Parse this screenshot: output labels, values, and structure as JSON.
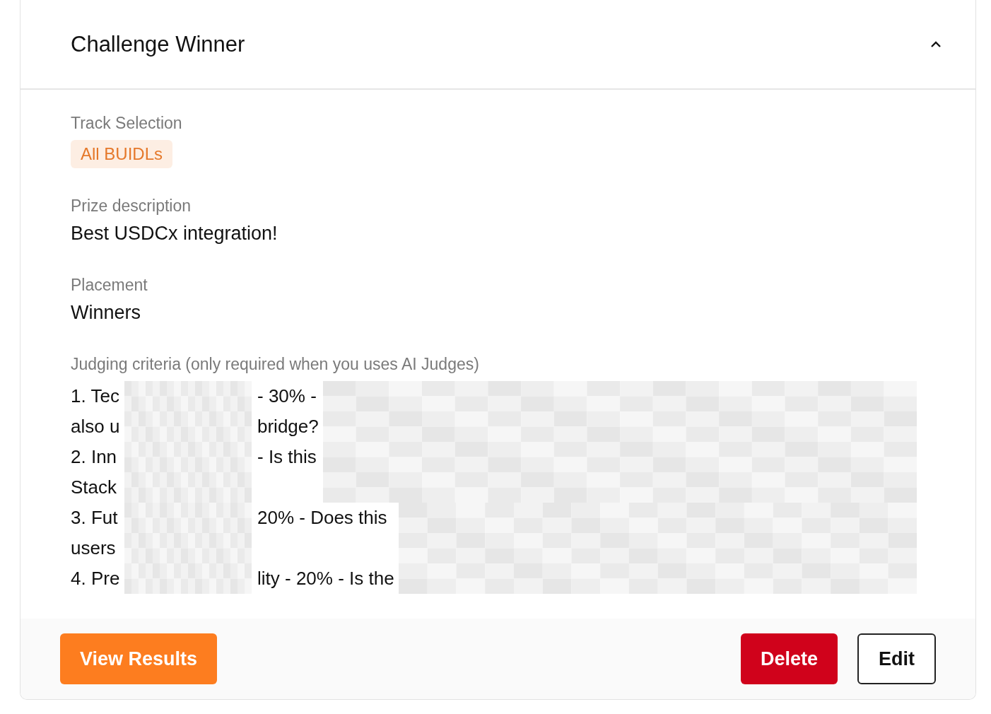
{
  "card": {
    "title": "Challenge Winner",
    "expanded": true
  },
  "track": {
    "label": "Track Selection",
    "tag": "All BUIDLs"
  },
  "prize": {
    "label": "Prize description",
    "value": "Best USDCx integration!"
  },
  "placement": {
    "label": "Placement",
    "value": "Winners"
  },
  "criteria": {
    "label": "Judging criteria (only required when you uses AI Judges)",
    "groups": [
      {
        "lines": [
          {
            "parts": [
              "1. Tec",
              "- 30% -"
            ]
          },
          {
            "parts": [
              "also u",
              "bridge?"
            ]
          },
          {
            "parts": [
              "2. Inn",
              "- Is this"
            ]
          },
          {
            "parts": [
              "Stack"
            ]
          }
        ]
      },
      {
        "lines": [
          {
            "parts": [
              "3. Fut",
              "20% - Does this"
            ]
          },
          {
            "parts": [
              "users"
            ]
          },
          {
            "parts": [
              "4. Pre",
              "lity - 20% - Is the"
            ]
          }
        ]
      }
    ]
  },
  "footer": {
    "primary": "View Results",
    "danger": "Delete",
    "secondary": "Edit"
  }
}
